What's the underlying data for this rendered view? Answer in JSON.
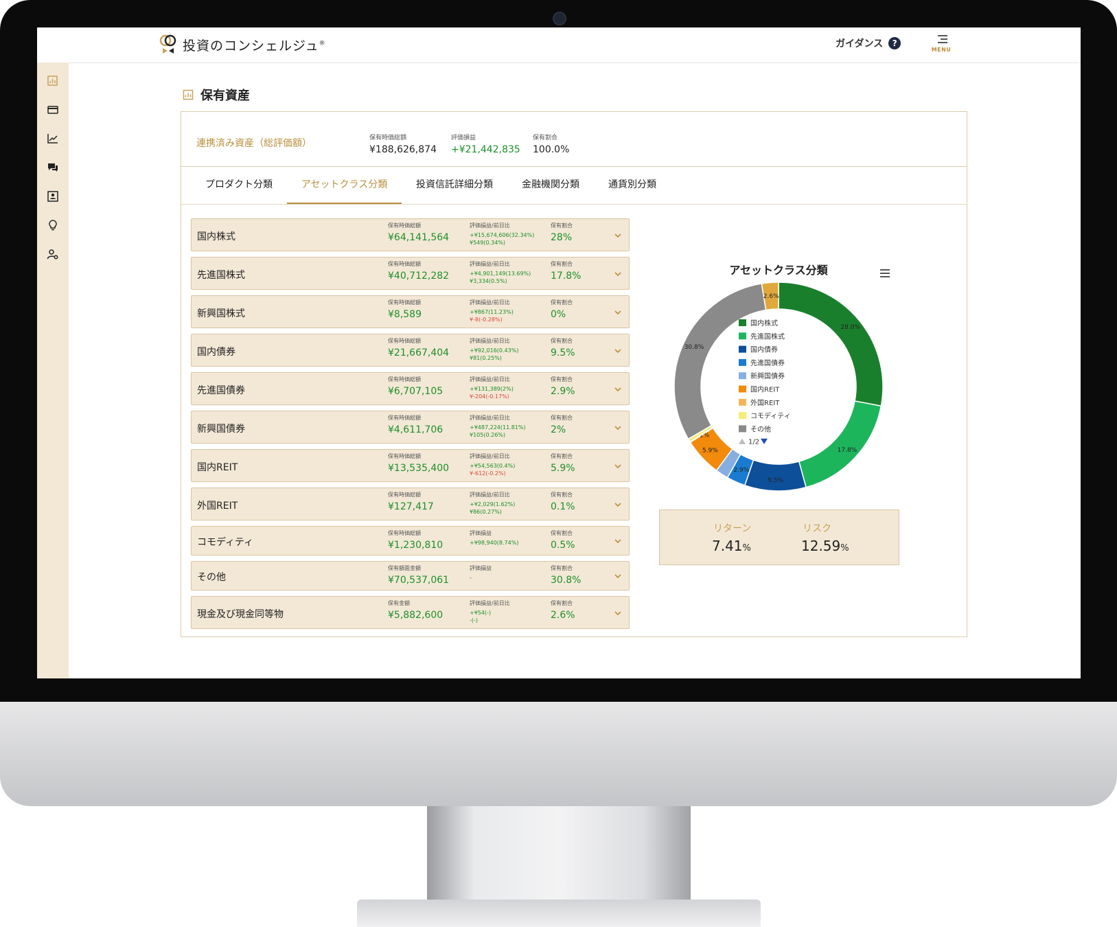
{
  "app": {
    "logo_text": "投資のコンシェルジュ",
    "logo_reg": "®",
    "guidance": "ガイダンス",
    "help": "?",
    "menu": "MENU"
  },
  "page": {
    "title": "保有資産"
  },
  "summary": {
    "label": "連携済み資産（総評価額）",
    "market_value_label": "保有時価総額",
    "market_value": "¥188,626,874",
    "pnl_label": "評価損益",
    "pnl": "+¥21,442,835",
    "ratio_label": "保有割合",
    "ratio": "100.0%"
  },
  "tabs": [
    {
      "label": "プロダクト分類",
      "active": false
    },
    {
      "label": "アセットクラス分類",
      "active": true
    },
    {
      "label": "投資信託詳細分類",
      "active": false
    },
    {
      "label": "金融機関分類",
      "active": false
    },
    {
      "label": "通貨別分類",
      "active": false
    }
  ],
  "assets": [
    {
      "name": "国内株式",
      "k1": "保有時価総額",
      "v1": "¥64,141,564",
      "k2": "評価損益/前日比",
      "d1": "+¥15,674,606(32.34%)",
      "d2": "¥549(0.34%)",
      "d2_neg": false,
      "k3": "保有割合",
      "v3": "28%"
    },
    {
      "name": "先進国株式",
      "k1": "保有時価総額",
      "v1": "¥40,712,282",
      "k2": "評価損益/前日比",
      "d1": "+¥4,901,149(13.69%)",
      "d2": "¥3,334(0.5%)",
      "d2_neg": false,
      "k3": "保有割合",
      "v3": "17.8%"
    },
    {
      "name": "新興国株式",
      "k1": "保有時価総額",
      "v1": "¥8,589",
      "k2": "評価損益/前日比",
      "d1": "+¥867(11.23%)",
      "d2": "¥-8(-0.28%)",
      "d2_neg": true,
      "k3": "保有割合",
      "v3": "0%"
    },
    {
      "name": "国内債券",
      "k1": "保有時価総額",
      "v1": "¥21,667,404",
      "k2": "評価損益/前日比",
      "d1": "+¥92,016(0.43%)",
      "d2": "¥81(0.25%)",
      "d2_neg": false,
      "k3": "保有割合",
      "v3": "9.5%"
    },
    {
      "name": "先進国債券",
      "k1": "保有時価総額",
      "v1": "¥6,707,105",
      "k2": "評価損益/前日比",
      "d1": "+¥131,389(2%)",
      "d2": "¥-204(-0.17%)",
      "d2_neg": true,
      "k3": "保有割合",
      "v3": "2.9%"
    },
    {
      "name": "新興国債券",
      "k1": "保有時価総額",
      "v1": "¥4,611,706",
      "k2": "評価損益/前日比",
      "d1": "+¥487,224(11.81%)",
      "d2": "¥105(0.26%)",
      "d2_neg": false,
      "k3": "保有割合",
      "v3": "2%"
    },
    {
      "name": "国内REIT",
      "k1": "保有時価総額",
      "v1": "¥13,535,400",
      "k2": "評価損益/前日比",
      "d1": "+¥54,563(0.4%)",
      "d2": "¥-612(-0.2%)",
      "d2_neg": true,
      "k3": "保有割合",
      "v3": "5.9%"
    },
    {
      "name": "外国REIT",
      "k1": "保有時価総額",
      "v1": "¥127,417",
      "k2": "評価損益/前日比",
      "d1": "+¥2,029(1.62%)",
      "d2": "¥86(0.27%)",
      "d2_neg": false,
      "k3": "保有割合",
      "v3": "0.1%"
    },
    {
      "name": "コモディティ",
      "k1": "保有時価総額",
      "v1": "¥1,230,810",
      "k2": "評価損益",
      "d1": "+¥98,940(8.74%)",
      "d2": "",
      "d2_neg": false,
      "k3": "保有割合",
      "v3": "0.5%"
    },
    {
      "name": "その他",
      "k1": "保有額面金額",
      "v1": "¥70,537,061",
      "k2": "評価損益",
      "d1": "-",
      "d2": "",
      "d2_neg": false,
      "k3": "保有割合",
      "v3": "30.8%"
    },
    {
      "name": "現金及び現金同等物",
      "k1": "保有金額",
      "v1": "¥5,882,600",
      "k2": "評価損益/前日比",
      "d1": "+¥54(-)",
      "d2": "-(-)",
      "d2_neg": false,
      "k3": "保有割合",
      "v3": "2.6%"
    }
  ],
  "chart_title": "アセットクラス分類",
  "chart_data": {
    "type": "pie",
    "title": "アセットクラス分類",
    "slices": [
      {
        "label": "国内株式",
        "value": 28.0,
        "text": "28.0%",
        "color": "#1a7f2c"
      },
      {
        "label": "先進国株式",
        "value": 17.8,
        "text": "17.8%",
        "color": "#1db55c"
      },
      {
        "label": "国内債券",
        "value": 9.5,
        "text": "9.5%",
        "color": "#0e4f9a"
      },
      {
        "label": "先進国債券",
        "value": 2.9,
        "text": "2.9%",
        "color": "#1a7bd0"
      },
      {
        "label": "新興国債券",
        "value": 2.0,
        "text": "",
        "color": "#86aee0"
      },
      {
        "label": "国内REIT",
        "value": 5.9,
        "text": "5.9%",
        "color": "#f28a0c"
      },
      {
        "label": "外国REIT",
        "value": 0.1,
        "text": "0.1%",
        "color": "#f3b55b"
      },
      {
        "label": "コモディティ",
        "value": 0.5,
        "text": "",
        "color": "#f6ec78"
      },
      {
        "label": "その他",
        "value": 30.8,
        "text": "30.8%",
        "color": "#8a8a8a"
      },
      {
        "label": "現金及び現金同等物",
        "value": 2.6,
        "text": "2.6%",
        "color": "#e0a83c"
      }
    ],
    "legend": [
      "国内株式",
      "先進国株式",
      "国内債券",
      "先進国債券",
      "新興国債券",
      "国内REIT",
      "外国REIT",
      "コモディティ",
      "その他"
    ],
    "legend_placement": "center",
    "legend_page": "1/2"
  },
  "risk_return": {
    "return_label": "リターン",
    "return_value": "7.41",
    "risk_label": "リスク",
    "risk_value": "12.59",
    "unit": "%"
  }
}
